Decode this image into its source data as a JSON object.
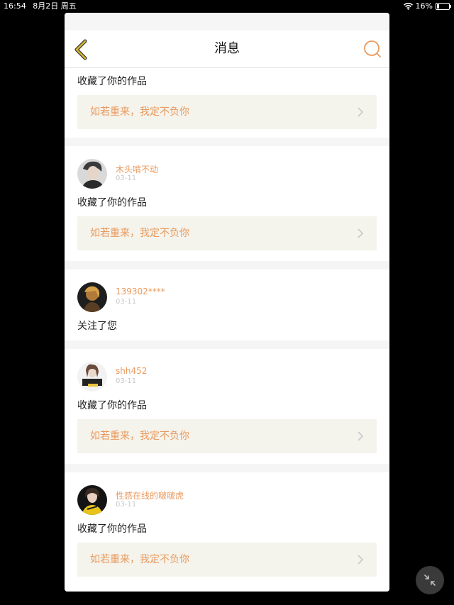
{
  "status_bar": {
    "time": "16:54",
    "date": "8月2日 周五",
    "battery": "16%",
    "icons": [
      "wifi-icon",
      "battery-icon"
    ]
  },
  "nav": {
    "title": "消息",
    "back_icon": "chevron-left-icon",
    "search_icon": "search-icon"
  },
  "colors": {
    "accent": "#e99a5e",
    "back_icon": "#c8ab2a",
    "card_bg": "#f4f3ec"
  },
  "messages": [
    {
      "action": "收藏了你的作品",
      "card_text": "如若重来，我定不负你"
    },
    {
      "username": "木头啃不动",
      "date": "03-11",
      "action": "收藏了你的作品",
      "card_text": "如若重来，我定不负你"
    },
    {
      "username": "139302****",
      "date": "03-11",
      "action": "关注了您"
    },
    {
      "username": "shh452",
      "date": "03-11",
      "action": "收藏了你的作品",
      "card_text": "如若重来，我定不负你"
    },
    {
      "username": "性感在线的啵啵虎",
      "date": "03-11",
      "action": "收藏了你的作品",
      "card_text": "如若重来，我定不负你"
    }
  ],
  "floating_button_icon": "collapse-arrows-icon"
}
